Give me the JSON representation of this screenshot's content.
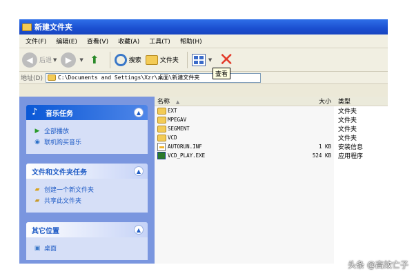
{
  "window": {
    "title": "新建文件夹"
  },
  "menu": [
    "文件(F)",
    "编辑(E)",
    "查看(V)",
    "收藏(A)",
    "工具(T)",
    "帮助(H)"
  ],
  "toolbar": {
    "back_label": "后退",
    "search_label": "搜索",
    "folders_label": "文件夹"
  },
  "address": {
    "label": "地址(D)",
    "value": "C:\\Documents and Settings\\Xzr\\桌面\\新建文件夹"
  },
  "tooltip": "查看",
  "tasks": {
    "music": {
      "title": "音乐任务",
      "items": [
        "全部播放",
        "联机购买音乐"
      ]
    },
    "file": {
      "title": "文件和文件夹任务",
      "items": [
        "创建一个新文件夹",
        "共享此文件夹"
      ]
    },
    "other": {
      "title": "其它位置",
      "items": [
        "桌面"
      ]
    }
  },
  "columns": {
    "name": "名称",
    "size": "大小",
    "type": "类型"
  },
  "files": [
    {
      "name": "EXT",
      "size": "",
      "type": "文件夹",
      "icon": "folder-icon"
    },
    {
      "name": "MPEGAV",
      "size": "",
      "type": "文件夹",
      "icon": "folder-icon"
    },
    {
      "name": "SEGMENT",
      "size": "",
      "type": "文件夹",
      "icon": "folder-icon"
    },
    {
      "name": "VCD",
      "size": "",
      "type": "文件夹",
      "icon": "folder-icon"
    },
    {
      "name": "AUTORUN.INF",
      "size": "1 KB",
      "type": "安装信息",
      "icon": "setup-info-icon"
    },
    {
      "name": "VCD_PLAY.EXE",
      "size": "524 KB",
      "type": "应用程序",
      "icon": "application-icon"
    }
  ],
  "watermark": "头条 @高效亡子"
}
